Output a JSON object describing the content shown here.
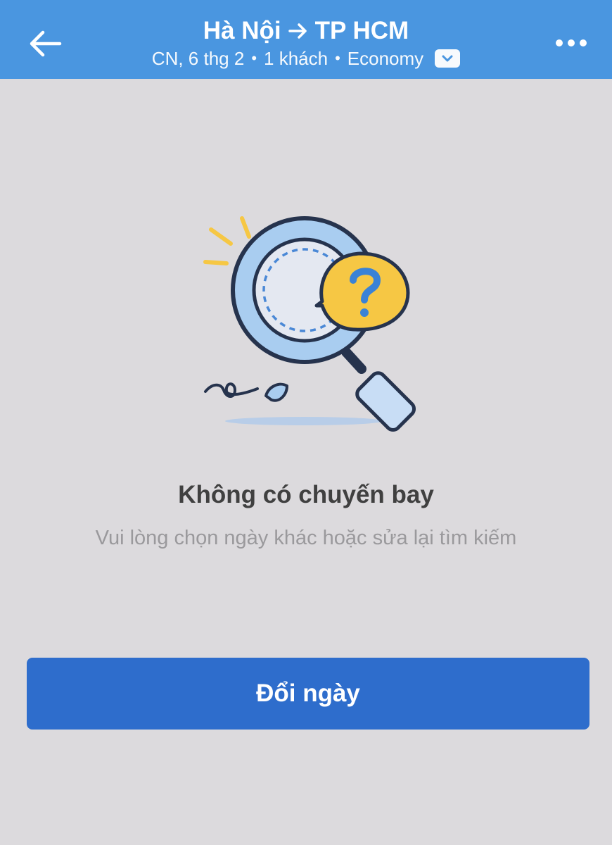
{
  "header": {
    "origin": "Hà Nội",
    "destination": "TP HCM",
    "date": "CN, 6 thg 2",
    "passengers": "1 khách",
    "cabin_class": "Economy",
    "back_icon": "arrow-left-icon",
    "more_icon": "more-horizontal-icon",
    "background_color": "#4a96e0"
  },
  "empty_state": {
    "illustration_icon": "magnifier-question-icon",
    "title": "Không có chuyến bay",
    "subtitle": "Vui lòng chọn ngày khác hoặc sửa lại tìm kiếm"
  },
  "actions": {
    "change_date_label": "Đổi ngày",
    "button_color": "#2e6dcc"
  }
}
